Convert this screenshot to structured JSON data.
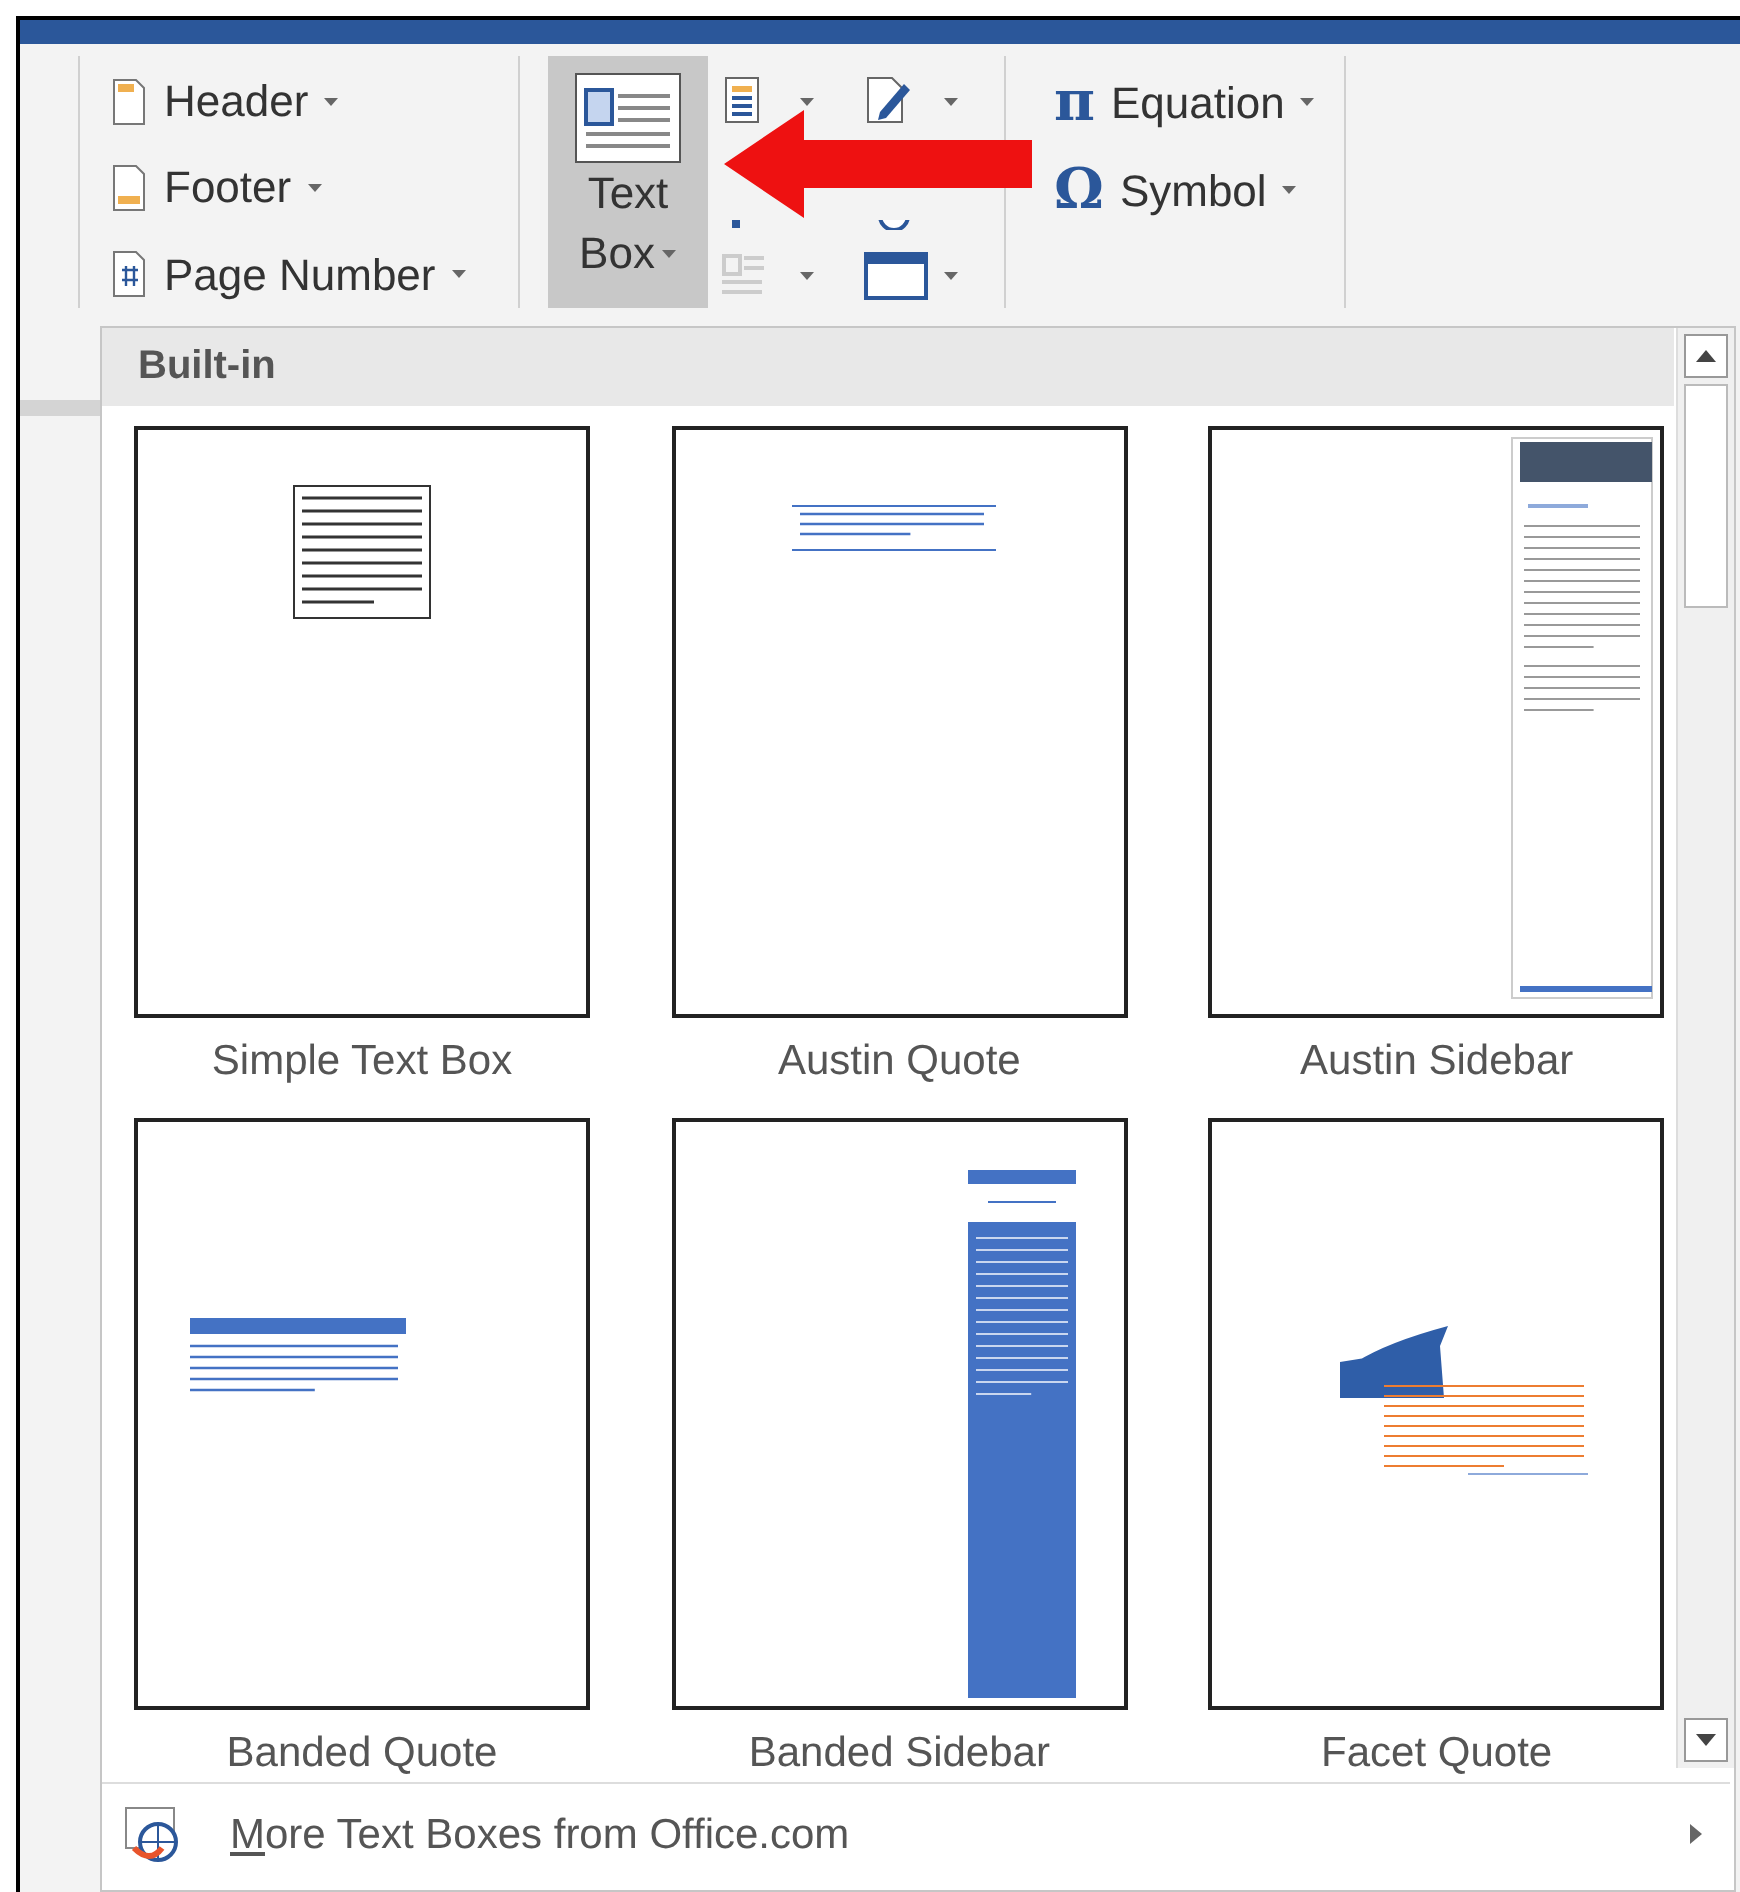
{
  "ribbon": {
    "header_footer": [
      {
        "label": "Header",
        "kind": "header"
      },
      {
        "label": "Footer",
        "kind": "footer"
      },
      {
        "label": "Page Number",
        "kind": "page-number"
      }
    ],
    "text_box_button": {
      "label_lines": [
        "Text",
        "Box"
      ],
      "pressed": true
    },
    "symbols": [
      {
        "glyph": "π",
        "label": "Equation"
      },
      {
        "glyph": "Ω",
        "label": "Symbol"
      }
    ]
  },
  "gallery": {
    "section_title": "Built-in",
    "items": [
      {
        "label": "Simple Text Box",
        "kind": "simple"
      },
      {
        "label": "Austin Quote",
        "kind": "austin-quote"
      },
      {
        "label": "Austin Sidebar",
        "kind": "austin-sidebar"
      },
      {
        "label": "Banded Quote",
        "kind": "banded-quote"
      },
      {
        "label": "Banded Sidebar",
        "kind": "banded-sidebar"
      },
      {
        "label": "Facet Quote",
        "kind": "facet-quote"
      }
    ],
    "more_link": "More Text Boxes from Office.com"
  }
}
